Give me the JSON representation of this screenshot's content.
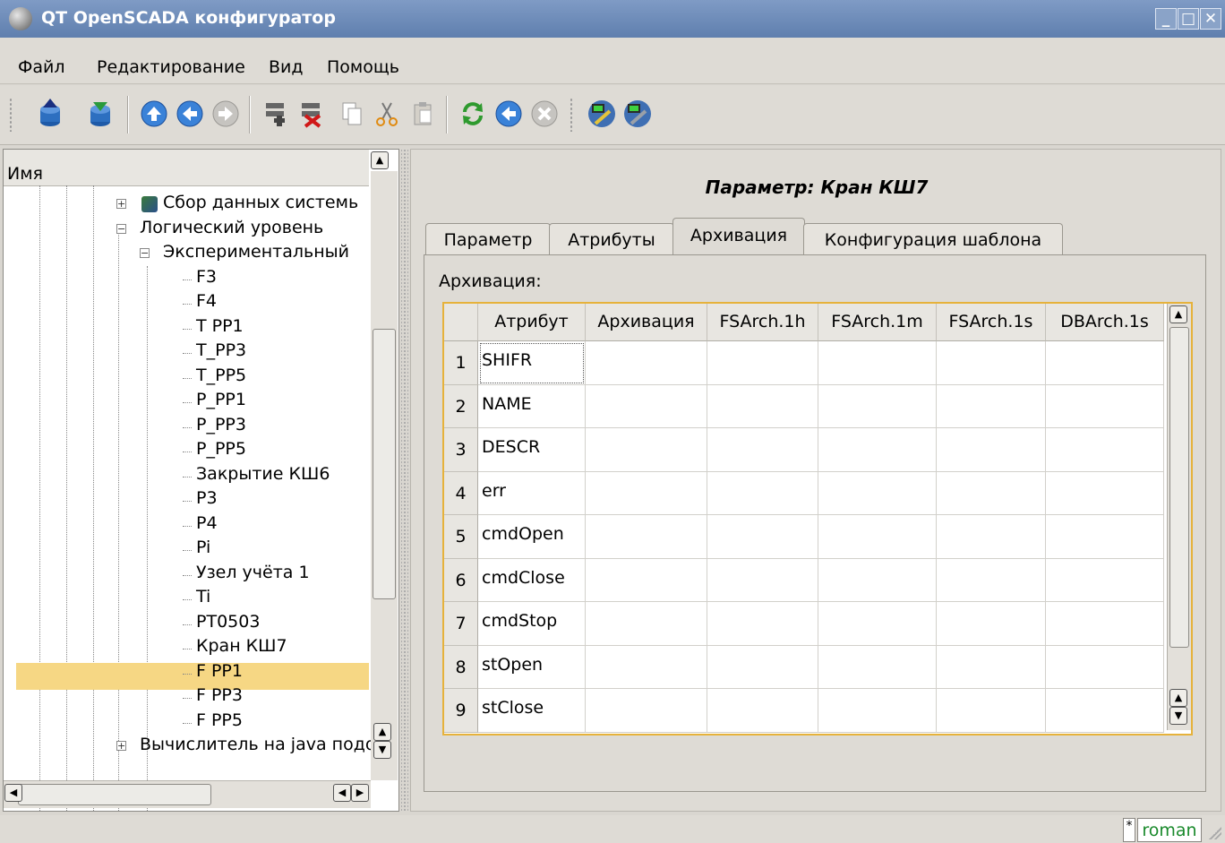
{
  "window": {
    "title": "QT OpenSCADA конфигуратор"
  },
  "menubar": {
    "items": [
      "Файл",
      "Редактирование",
      "Вид",
      "Помощь"
    ]
  },
  "toolbar": {
    "icons": [
      "db-load-icon",
      "db-save-icon",
      "up-icon",
      "back-icon",
      "forward-icon",
      "add-item-icon",
      "delete-item-icon",
      "copy-icon",
      "cut-icon",
      "paste-icon",
      "refresh-icon",
      "start-icon",
      "stop-icon",
      "module-icon-1",
      "module-icon-2"
    ]
  },
  "tree": {
    "header": "Имя",
    "nodes": [
      {
        "label": "Сбор данных системь",
        "level": 0
      },
      {
        "label": "Логический уровень",
        "level": 0
      },
      {
        "label": "Экспериментальный",
        "level": 1
      },
      {
        "label": "F3",
        "level": 2
      },
      {
        "label": "F4",
        "level": 2
      },
      {
        "label": "T PP1",
        "level": 2
      },
      {
        "label": "T_PP3",
        "level": 2
      },
      {
        "label": "T_PP5",
        "level": 2
      },
      {
        "label": "P_PP1",
        "level": 2
      },
      {
        "label": "P_PP3",
        "level": 2
      },
      {
        "label": "P_PP5",
        "level": 2
      },
      {
        "label": "Закрытие КШ6",
        "level": 2
      },
      {
        "label": "P3",
        "level": 2
      },
      {
        "label": "P4",
        "level": 2
      },
      {
        "label": "Pi",
        "level": 2
      },
      {
        "label": "Узел учёта 1",
        "level": 2
      },
      {
        "label": "Ti",
        "level": 2
      },
      {
        "label": "PT0503",
        "level": 2
      },
      {
        "label": "Кран КШ7",
        "level": 2,
        "selected": true
      },
      {
        "label": "F PP1",
        "level": 2
      },
      {
        "label": "F PP3",
        "level": 2
      },
      {
        "label": "F PP5",
        "level": 2
      },
      {
        "label": "Вычислитель на java подо",
        "level": 0
      }
    ]
  },
  "main": {
    "title": "Параметр: Кран КШ7",
    "tabs": [
      "Параметр",
      "Атрибуты",
      "Архивация",
      "Конфигурация шаблона"
    ],
    "active_tab": "Архивация",
    "section_label": "Архивация:",
    "table": {
      "columns": [
        "Атрибут",
        "Архивация",
        "FSArch.1h",
        "FSArch.1m",
        "FSArch.1s",
        "DBArch.1s"
      ],
      "rows": [
        {
          "n": "1",
          "attr": "SHIFR"
        },
        {
          "n": "2",
          "attr": "NAME"
        },
        {
          "n": "3",
          "attr": "DESCR"
        },
        {
          "n": "4",
          "attr": "err"
        },
        {
          "n": "5",
          "attr": "cmdOpen"
        },
        {
          "n": "6",
          "attr": "cmdClose"
        },
        {
          "n": "7",
          "attr": "cmdStop"
        },
        {
          "n": "8",
          "attr": "stOpen"
        },
        {
          "n": "9",
          "attr": "stClose"
        }
      ]
    }
  },
  "status": {
    "modified_flag": "*",
    "user": "roman"
  },
  "colors": {
    "selection": "#f6d784",
    "titlebar": "#6a88b6",
    "table_focus_border": "#e6b23b",
    "user_text": "#1a8a2c"
  }
}
